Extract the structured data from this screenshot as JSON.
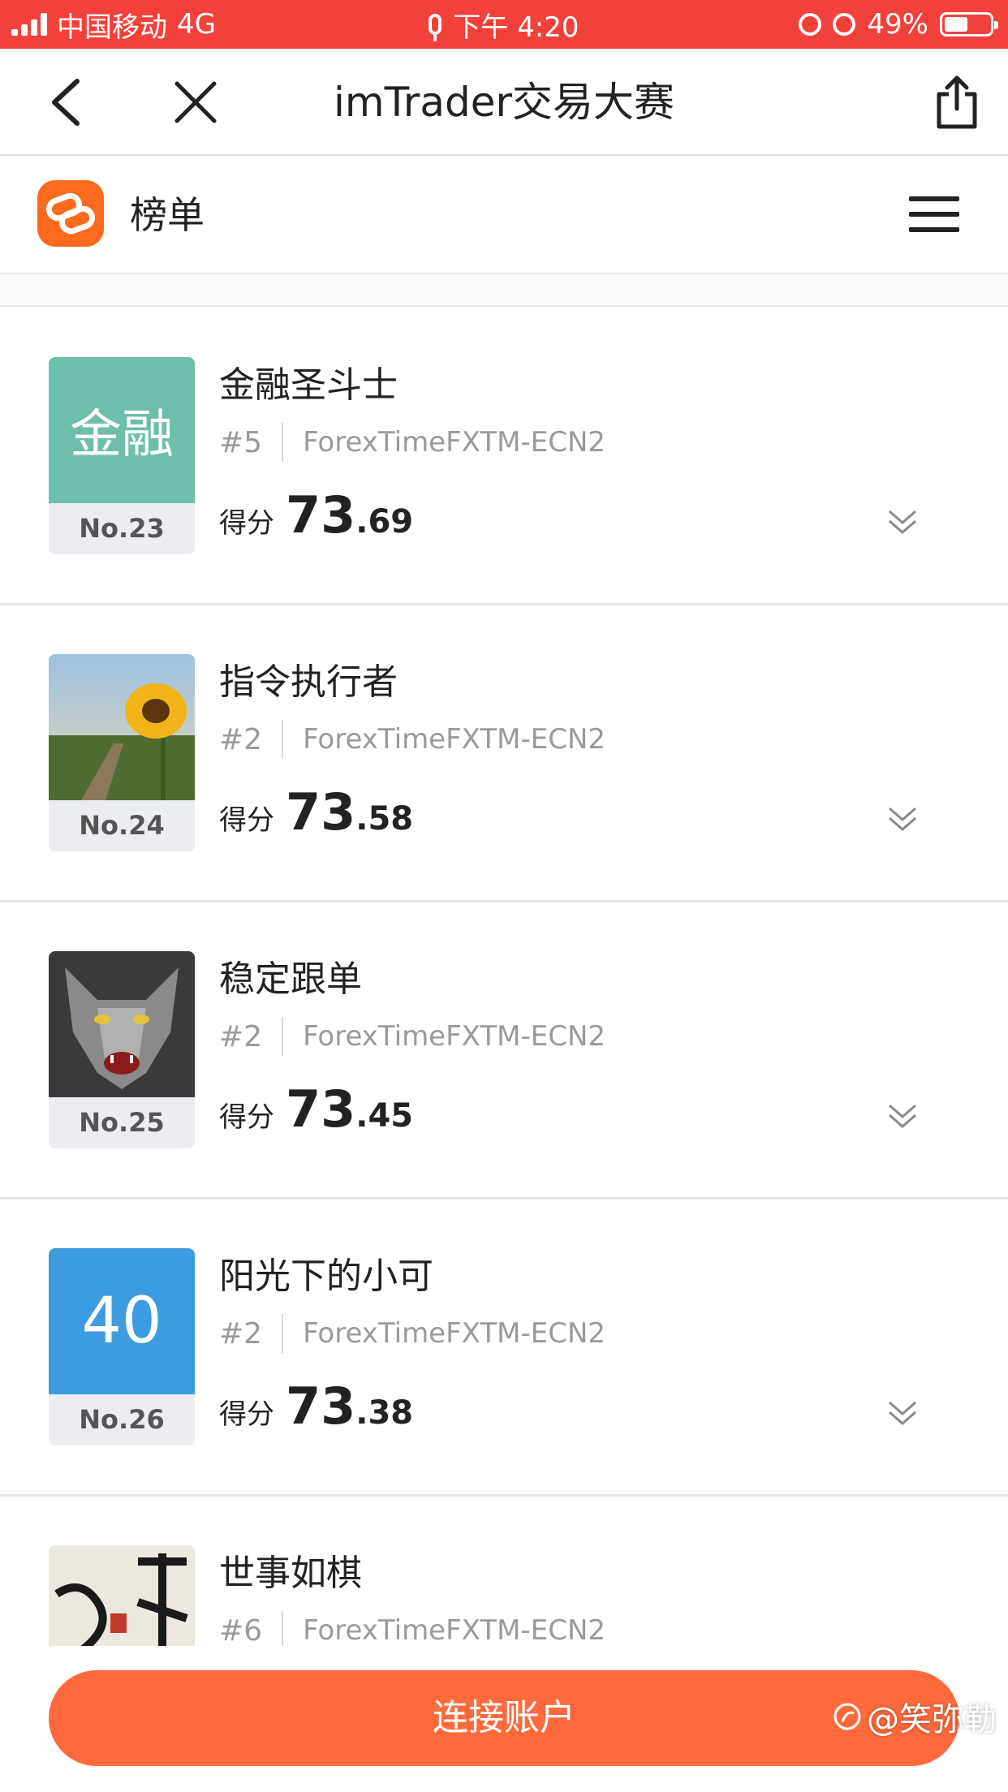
{
  "status_bar": {
    "carrier": "中国移动",
    "network": "4G",
    "time": "下午 4:20",
    "battery": "49%",
    "bar_color": "#f2413a"
  },
  "nav": {
    "title": "imTrader交易大赛",
    "back_icon": "chevron-left-icon",
    "close_icon": "close-icon",
    "share_icon": "share-icon"
  },
  "app_header": {
    "title": "榜单",
    "logo_icon": "imtrader-logo-icon",
    "menu_icon": "hamburger-menu-icon",
    "brand_color": "#ff6a1c"
  },
  "entries": [
    {
      "rank": "No.23",
      "name": "金融圣斗士",
      "tag": "#5",
      "server": "ForexTimeFXTM-ECN2",
      "score_label": "得分",
      "score_int": "73",
      "score_dec": ".69",
      "avatar_text": "金融",
      "avatar_color": "#6dbeaa"
    },
    {
      "rank": "No.24",
      "name": "指令执行者",
      "tag": "#2",
      "server": "ForexTimeFXTM-ECN2",
      "score_label": "得分",
      "score_int": "73",
      "score_dec": ".58",
      "avatar_kind": "sunflower-photo"
    },
    {
      "rank": "No.25",
      "name": "稳定跟单",
      "tag": "#2",
      "server": "ForexTimeFXTM-ECN2",
      "score_label": "得分",
      "score_int": "73",
      "score_dec": ".45",
      "avatar_kind": "wolf-photo"
    },
    {
      "rank": "No.26",
      "name": "阳光下的小可",
      "tag": "#2",
      "server": "ForexTimeFXTM-ECN2",
      "score_label": "得分",
      "score_int": "73",
      "score_dec": ".38",
      "avatar_text": "40",
      "avatar_color": "#3d9be0"
    },
    {
      "name": "世事如棋",
      "tag": "#6",
      "server": "ForexTimeFXTM-ECN2",
      "avatar_kind": "calligraphy-photo"
    }
  ],
  "cta": {
    "label": "连接账户",
    "color": "#ff6a3d"
  },
  "watermark": "@笑弥勒"
}
